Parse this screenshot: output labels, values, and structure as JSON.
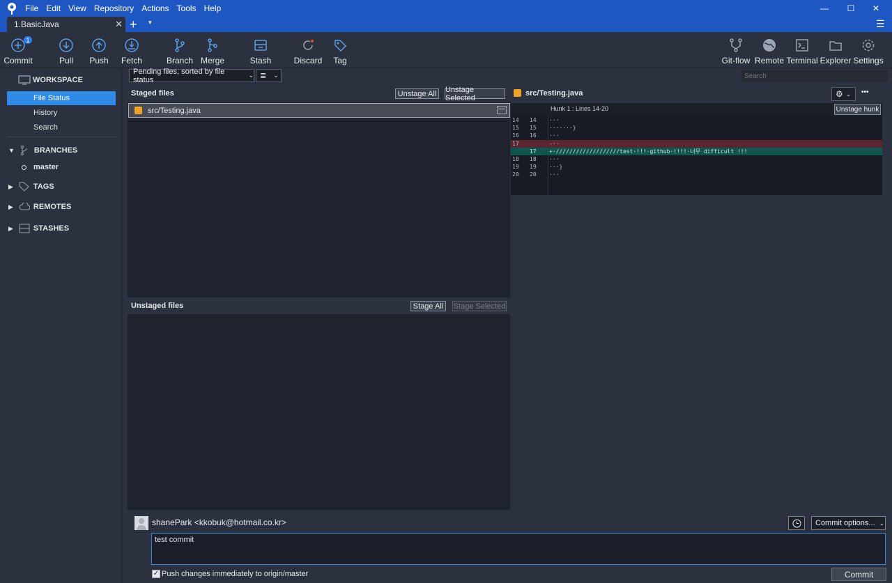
{
  "menu": [
    "File",
    "Edit",
    "View",
    "Repository",
    "Actions",
    "Tools",
    "Help"
  ],
  "window_controls": {
    "minimize": "—",
    "maximize": "☐",
    "close": "✕"
  },
  "tab": {
    "label": "1.BasicJava",
    "close": "✕",
    "add": "+",
    "dropdown": "▾",
    "menu": "☰"
  },
  "toolbar": {
    "commit": "Commit",
    "commit_badge": "1",
    "pull": "Pull",
    "push": "Push",
    "fetch": "Fetch",
    "branch": "Branch",
    "merge": "Merge",
    "stash": "Stash",
    "discard": "Discard",
    "tag": "Tag",
    "gitflow": "Git-flow",
    "remote": "Remote",
    "terminal": "Terminal",
    "explorer": "Explorer",
    "settings": "Settings"
  },
  "sidebar": {
    "workspace": "WORKSPACE",
    "file_status": "File Status",
    "history": "History",
    "search": "Search",
    "branches": "BRANCHES",
    "branch_current": "master",
    "tags": "TAGS",
    "remotes": "REMOTES",
    "stashes": "STASHES"
  },
  "filter": {
    "sort_label": "Pending files, sorted by file status",
    "view_icon": "≣"
  },
  "search": {
    "placeholder": "Search"
  },
  "staged": {
    "title": "Staged files",
    "unstage_all": "Unstage All",
    "unstage_selected": "Unstage Selected",
    "files": [
      "src/Testing.java"
    ],
    "row_action": "—"
  },
  "unstaged": {
    "title": "Unstaged files",
    "stage_all": "Stage All",
    "stage_selected": "Stage Selected"
  },
  "diff": {
    "file": "src/Testing.java",
    "hunk_title": "Hunk 1 : Lines 14-20",
    "unstage_hunk": "Unstage hunk",
    "more": "•••",
    "lines": [
      {
        "old": "14",
        "new": "14",
        "text": "···",
        "type": "ctx"
      },
      {
        "old": "15",
        "new": "15",
        "text": "·······}",
        "type": "ctx"
      },
      {
        "old": "16",
        "new": "16",
        "text": "···",
        "type": "ctx"
      },
      {
        "old": "17",
        "new": "",
        "text": "-··",
        "type": "del"
      },
      {
        "old": "",
        "new": "17",
        "text": "+·///////////////////test·!!!·github·!!!!·너무 difficult !!!",
        "type": "add"
      },
      {
        "old": "18",
        "new": "18",
        "text": "···",
        "type": "ctx"
      },
      {
        "old": "19",
        "new": "19",
        "text": "···}",
        "type": "ctx"
      },
      {
        "old": "20",
        "new": "20",
        "text": "···",
        "type": "ctx"
      }
    ]
  },
  "commit": {
    "author": "shanePark <kkobuk@hotmail.co.kr>",
    "message": "test commit",
    "options": "Commit options...",
    "push_label": "Push changes immediately to origin/master",
    "push_checked": "✓",
    "button": "Commit"
  },
  "colors": {
    "accent": "#1f57c2",
    "selected": "#2e8be8",
    "added": "#10554e",
    "deleted": "#5c2630"
  }
}
